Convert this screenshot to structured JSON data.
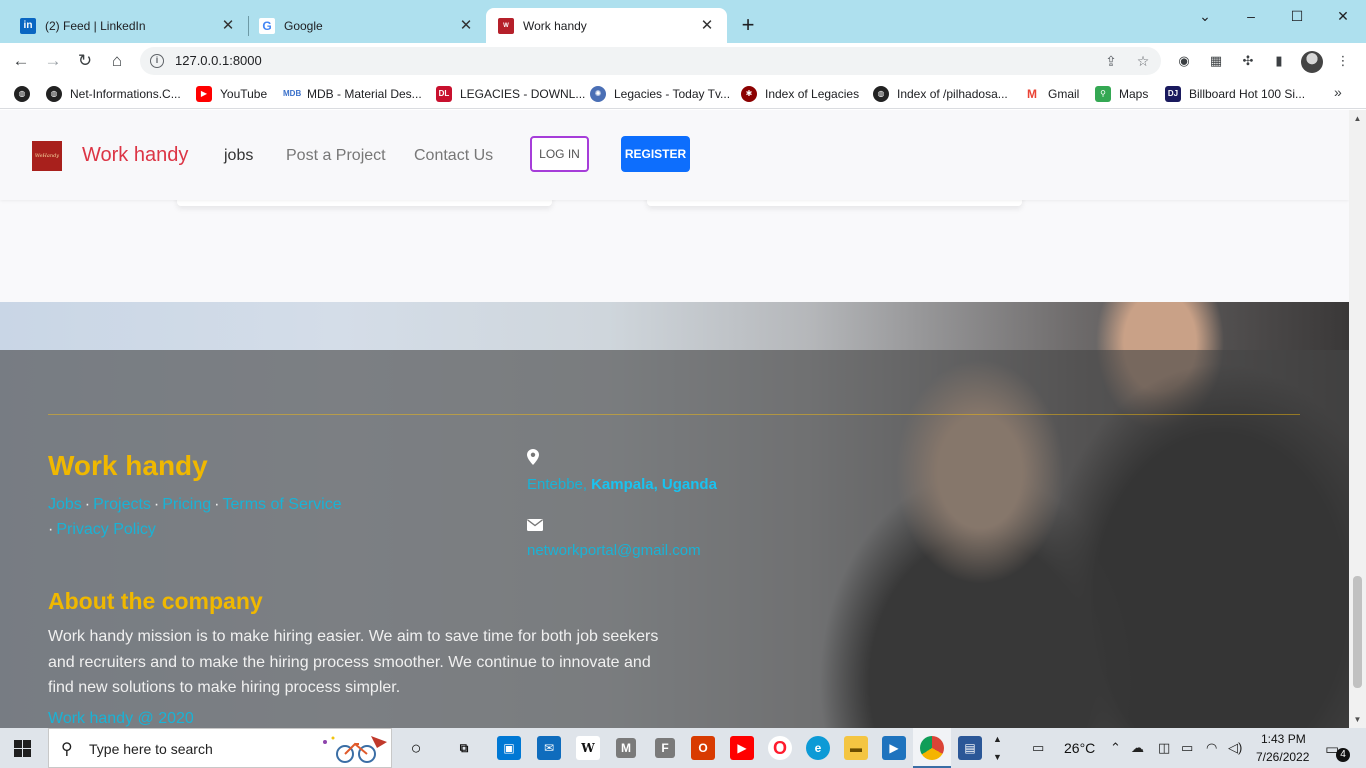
{
  "browser": {
    "tabs": [
      {
        "label": "(2) Feed | LinkedIn",
        "favicon": "linkedin-icon",
        "color": "#0a66c2",
        "active": false
      },
      {
        "label": "Google",
        "favicon": "google-icon",
        "color": "#ffffff",
        "active": false
      },
      {
        "label": "Work handy",
        "favicon": "workhandy-icon",
        "color": "#b5202a",
        "active": true
      }
    ],
    "new_tab": "+",
    "window_controls": {
      "minimize": "–",
      "maximize": "☐",
      "close": "✕",
      "tab_search": "⌄"
    },
    "url": "127.0.0.1:8000",
    "bookmarks": [
      {
        "label": "",
        "icon": "globe-icon"
      },
      {
        "label": "Net-Informations.C...",
        "icon": "globe-icon"
      },
      {
        "label": "YouTube",
        "icon": "youtube-icon",
        "color": "#ff0000"
      },
      {
        "label": "MDB - Material Des...",
        "icon": "mdb-icon",
        "color": "#3b71ca"
      },
      {
        "label": "LEGACIES - DOWNL...",
        "icon": "dl-icon",
        "color": "#c8102e"
      },
      {
        "label": "Legacies - Today Tv...",
        "icon": "film-icon",
        "color": "#4a6fb5"
      },
      {
        "label": "Index of Legacies",
        "icon": "spider-icon",
        "color": "#8b0000"
      },
      {
        "label": "Index of /pilhadosa...",
        "icon": "globe-icon"
      },
      {
        "label": "Gmail",
        "icon": "gmail-icon",
        "color": "#ea4335"
      },
      {
        "label": "Maps",
        "icon": "maps-icon",
        "color": "#34a853"
      },
      {
        "label": "Billboard Hot 100 Si...",
        "icon": "dj-icon",
        "color": "#1a1a5e"
      }
    ],
    "bookmarks_more": "»"
  },
  "site": {
    "brand": "Work handy",
    "logo_text": "WeHandy",
    "nav": {
      "jobs": "jobs",
      "post": "Post a Project",
      "contact": "Contact Us"
    },
    "login": "LOG IN",
    "register": "REGISTER",
    "footer": {
      "title": "Work handy",
      "links": [
        "Jobs",
        "Projects",
        "Pricing",
        "Terms of Service",
        "Privacy Policy"
      ],
      "link_separator": "·",
      "location_label": "Entebbe,",
      "location_value": "Kampala, Uganda",
      "email": "networkportal@gmail.com",
      "about_title": "About the company",
      "about_text": "Work handy mission is to make hiring easier. We aim to save time for both job seekers and recruiters and to make the hiring process smoother. We continue to innovate and find new solutions to make hiring process simpler.",
      "copyright": "Work handy @ 2020"
    },
    "colors": {
      "brand": "#dc3545",
      "footer_heading": "#f0b800",
      "footer_link": "#19b3d6",
      "register": "#0d6efd",
      "login_border": "#a63dd9"
    }
  },
  "taskbar": {
    "search_placeholder": "Type here to search",
    "weather": "26°C",
    "time": "1:43 PM",
    "date": "7/26/2022",
    "notifications": "4",
    "apps": [
      "cortana-icon",
      "task-view-icon",
      "store-icon",
      "mail-icon",
      "wikipedia-icon",
      "m-app-icon",
      "f-app-icon",
      "office-icon",
      "youtube-icon",
      "opera-icon",
      "edge-icon",
      "file-explorer-icon",
      "media-player-icon",
      "chrome-icon",
      "remote-desktop-icon"
    ]
  }
}
